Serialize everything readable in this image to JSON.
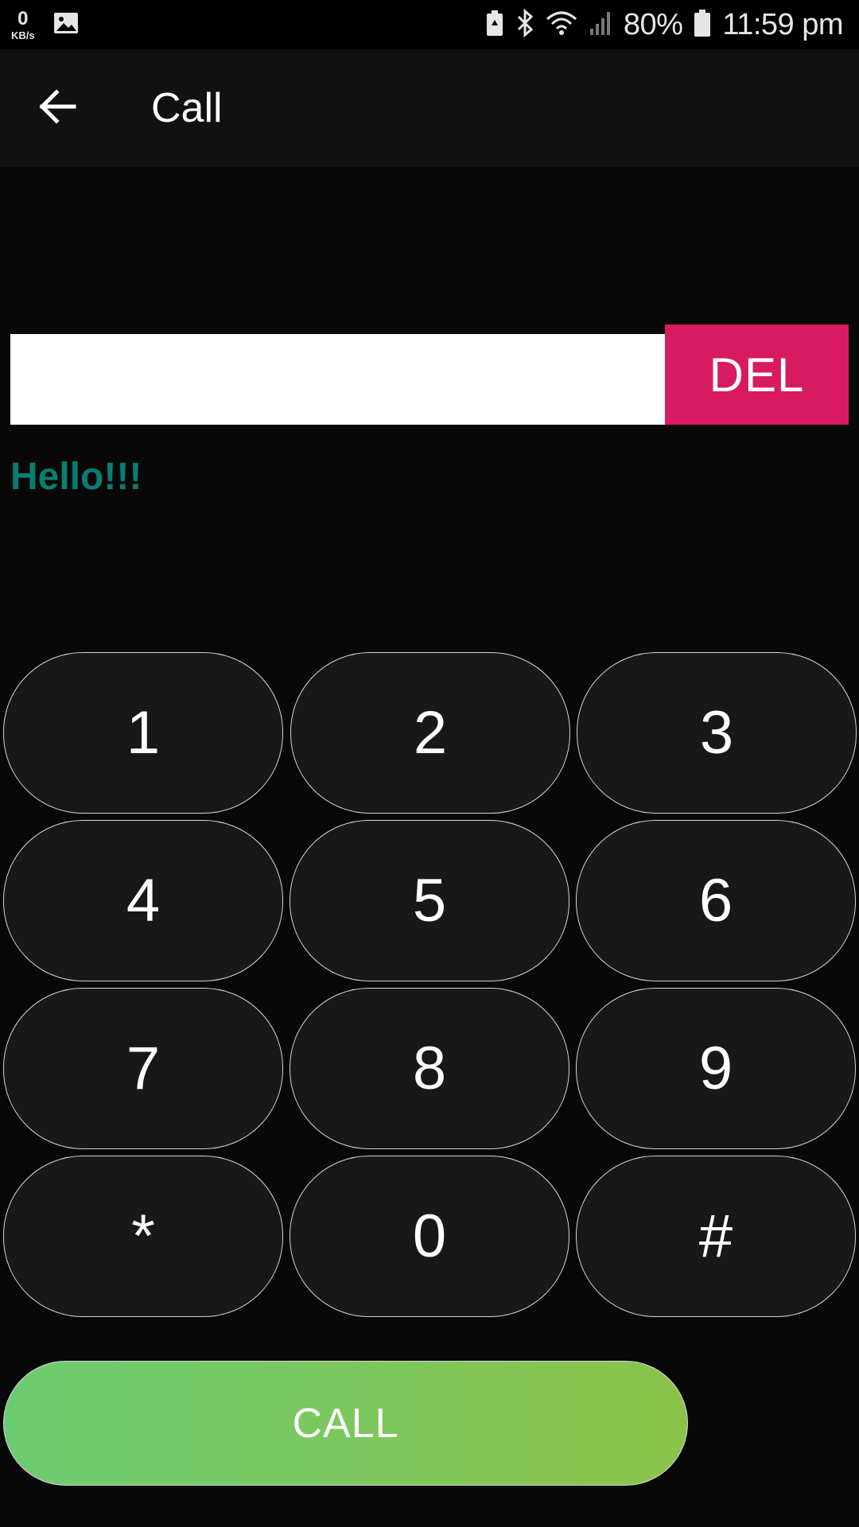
{
  "status_bar": {
    "net_speed": "0",
    "net_unit": "KB/s",
    "battery": "80%",
    "time": "11:59 pm"
  },
  "app_bar": {
    "title": "Call",
    "back_icon": "arrow-left-icon"
  },
  "dialer": {
    "input_value": "",
    "delete_label": "DEL",
    "greeting": "Hello!!!",
    "keys": [
      "1",
      "2",
      "3",
      "4",
      "5",
      "6",
      "7",
      "8",
      "9",
      "*",
      "0",
      "#"
    ],
    "call_label": "CALL"
  },
  "colors": {
    "delete_button": "#d81b60",
    "greeting": "#0a7d70",
    "call_gradient_start": "#6ccc72",
    "call_gradient_end": "#8bc34a",
    "key_background": "#181818",
    "app_bar": "#111111"
  }
}
